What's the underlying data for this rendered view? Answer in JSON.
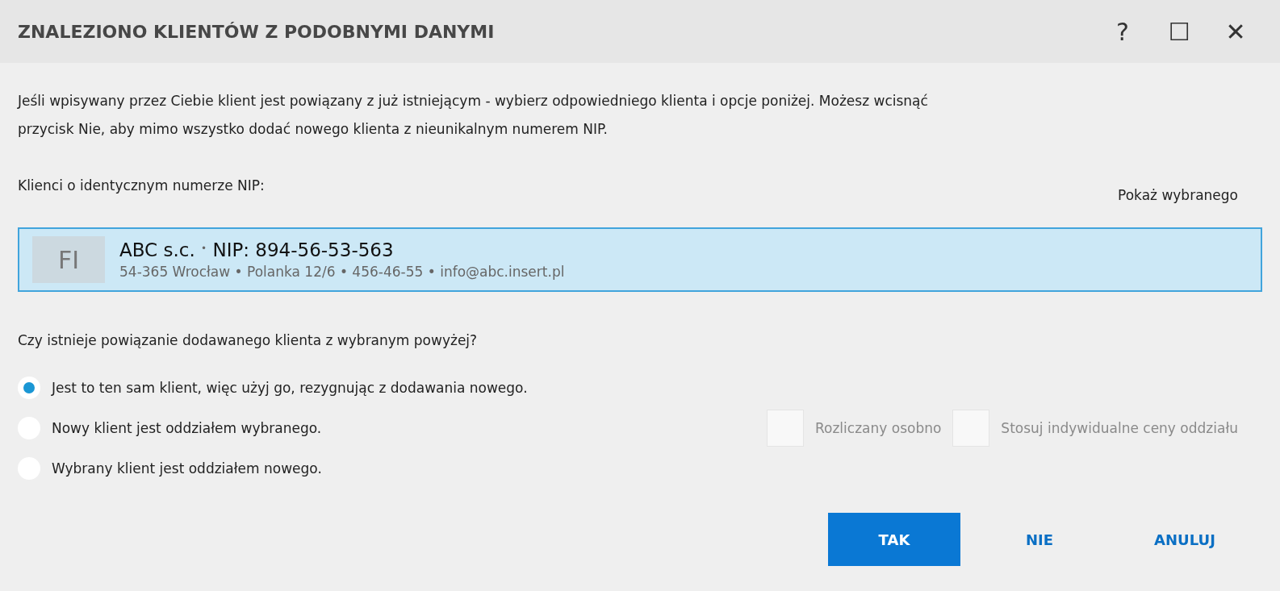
{
  "window": {
    "title": "ZNALEZIONO KLIENTÓW Z PODOBNYMI DANYMI",
    "controls": [
      "?",
      "☐",
      "✕"
    ]
  },
  "intro": "Jeśli wpisywany przez Ciebie klient jest powiązany z już istniejącym - wybierz odpowiedniego klienta i opcje poniżej. Możesz wcisnąć przycisk Nie, aby mimo wszystko dodać nowego klienta z nieunikalnym numerem NIP.",
  "list_label": "Klienci o identycznym numerze NIP:",
  "show_selected_link": "Pokaż wybranego",
  "clients": [
    {
      "initials": "FI",
      "name": "ABC s.c.",
      "separator": "•",
      "nip": "NIP: 894-56-53-563",
      "details": "54-365 Wrocław • Polanka  12/6  • 456-46-55 • info@abc.insert.pl",
      "selected": true
    }
  ],
  "question": "Czy istnieje powiązanie dodawanego klienta z wybranym powyżej?",
  "options": [
    {
      "label": "Jest to ten sam klient, więc użyj go, rezygnując z dodawania nowego.",
      "selected": true
    },
    {
      "label": "Nowy klient jest oddziałem wybranego.",
      "selected": false,
      "checkboxes": [
        {
          "label": "Rozliczany osobno",
          "checked": false,
          "disabled": true
        },
        {
          "label": "Stosuj indywidualne ceny oddziału",
          "checked": false,
          "disabled": true
        }
      ]
    },
    {
      "label": "Wybrany klient jest oddziałem nowego.",
      "selected": false
    }
  ],
  "buttons": [
    {
      "label": "TAK",
      "primary": true
    },
    {
      "label": "NIE",
      "primary": false
    },
    {
      "label": "ANULUJ",
      "primary": false
    }
  ]
}
